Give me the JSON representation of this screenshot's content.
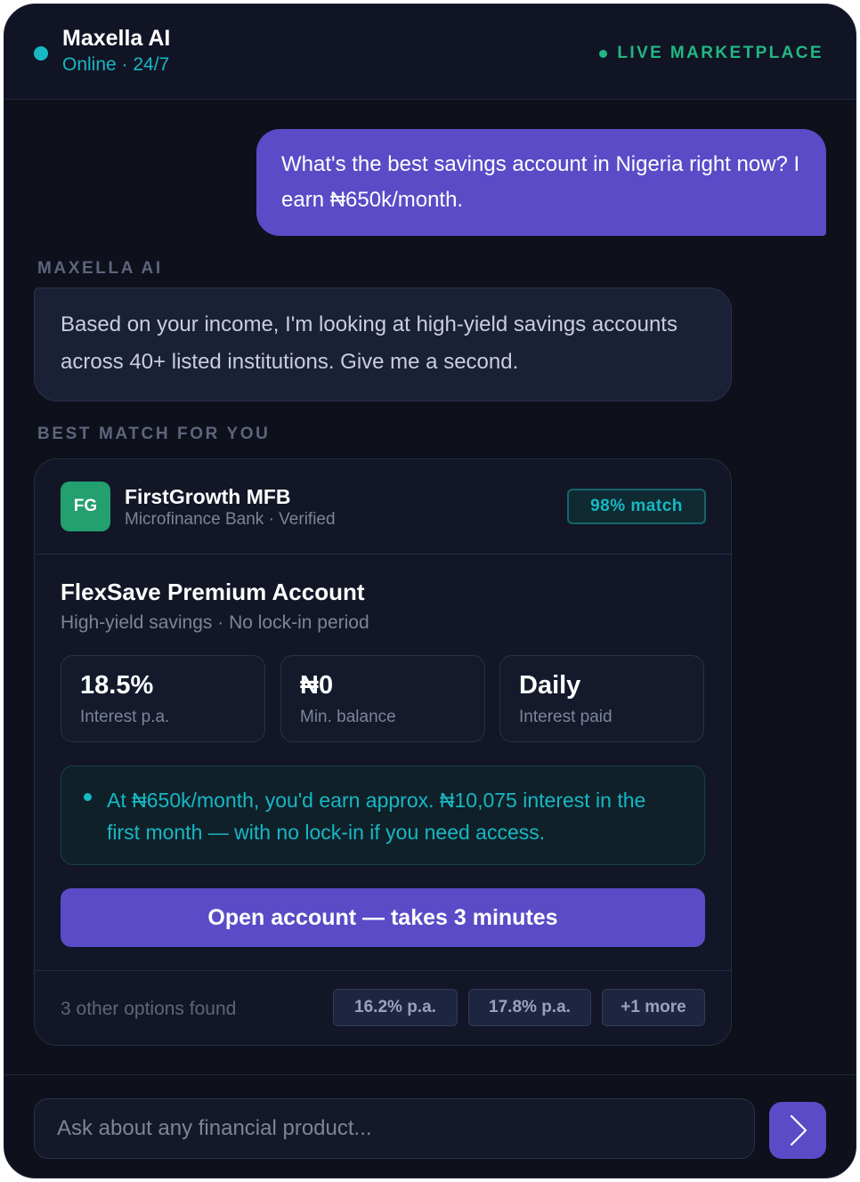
{
  "header": {
    "title": "Maxella AI",
    "subtitle": "Online · 24/7",
    "live_label": "LIVE MARKETPLACE"
  },
  "conversation": {
    "user_message": "What's the best savings account in Nigeria right now? I earn ₦650k/month.",
    "ai_label": "MAXELLA AI",
    "ai_message": "Based on your income, I'm looking at high-yield savings accounts across 40+ listed institutions. Give me a second.",
    "best_match_label": "BEST MATCH FOR YOU"
  },
  "card": {
    "logo_initials": "FG",
    "institution_name": "FirstGrowth MFB",
    "institution_meta": "Microfinance Bank · Verified",
    "match_badge": "98% match",
    "product_name": "FlexSave Premium Account",
    "product_desc": "High-yield savings · No lock-in period",
    "stats": [
      {
        "value": "18.5%",
        "label": "Interest p.a."
      },
      {
        "value": "₦0",
        "label": "Min. balance"
      },
      {
        "value": "Daily",
        "label": "Interest paid"
      }
    ],
    "insight": "At ₦650k/month, you'd earn approx. ₦10,075 interest in the first month — with no lock-in if you need access.",
    "cta_label": "Open account — takes 3 minutes",
    "others_label": "3 other options found",
    "other_options": [
      "16.2% p.a.",
      "17.8% p.a.",
      "+1 more"
    ]
  },
  "input": {
    "placeholder": "Ask about any financial product..."
  },
  "colors": {
    "accent": "#5b4bc7",
    "teal": "#17b8c4",
    "green": "#20b883",
    "background": "#0e101c"
  }
}
